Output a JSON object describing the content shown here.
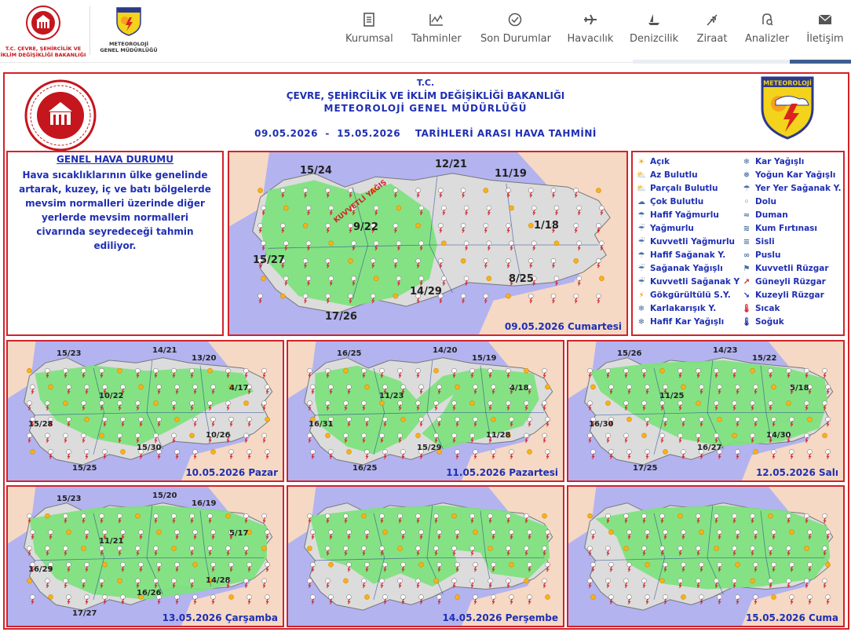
{
  "header": {
    "ministry_logo_text": [
      "T.C. ÇEVRE, ŞEHİRCİLİK VE",
      "İKLİM DEĞİŞİKLİĞİ BAKANLIĞI"
    ],
    "mgm_logo_text": [
      "METEOROLOJİ",
      "GENEL MÜDÜRLÜĞÜ"
    ],
    "shield_text": "METEOROLOJİ",
    "nav": [
      {
        "label": "Kurumsal",
        "icon": "document-icon"
      },
      {
        "label": "Tahminler",
        "icon": "chart-icon"
      },
      {
        "label": "Son Durumlar",
        "icon": "clock-icon"
      },
      {
        "label": "Havacılık",
        "icon": "airplane-icon"
      },
      {
        "label": "Denizcilik",
        "icon": "ship-icon"
      },
      {
        "label": "Ziraat",
        "icon": "wheat-icon"
      },
      {
        "label": "Analizler",
        "icon": "analysis-icon"
      },
      {
        "label": "İletişim",
        "icon": "envelope-icon"
      }
    ]
  },
  "forecast": {
    "title_lines": [
      "T.C.",
      "ÇEVRE, ŞEHİRCİLİK VE İKLİM DEĞİŞİKLİĞİ BAKANLIĞI",
      "METEOROLOJİ GENEL MÜDÜRLÜĞÜ"
    ],
    "date_line": "09.05.2026  -  15.05.2026    TARİHLERİ ARASI HAVA TAHMİNİ",
    "genel_title": "GENEL HAVA DURUMU",
    "genel_text": "Hava sıcaklıklarının ülke genelinde artarak, kuzey, iç ve batı bölgelerde mevsim normalleri üzerinde diğer yerlerde mevsim normalleri civarında seyredeceği tahmin ediliyor.",
    "main_map": {
      "caption": "09.05.2026 Cumartesi",
      "warning_label": "KUVVETLİ YAĞIŞ",
      "temps": [
        "15/24",
        "12/21",
        "11/19",
        "9/22",
        "1/18",
        "15/27",
        "8/25",
        "14/29",
        "17/26"
      ]
    },
    "days": [
      {
        "caption": "10.05.2026 Pazar",
        "temps": [
          "15/23",
          "14/21",
          "13/20",
          "10/22",
          "4/17",
          "15/28",
          "10/26",
          "15/30",
          "15/25"
        ]
      },
      {
        "caption": "11.05.2026 Pazartesi",
        "temps": [
          "16/25",
          "14/20",
          "15/19",
          "11/23",
          "4/18",
          "16/31",
          "11/28",
          "15/29",
          "16/25"
        ]
      },
      {
        "caption": "12.05.2026 Salı",
        "temps": [
          "15/26",
          "14/23",
          "15/22",
          "11/25",
          "5/18",
          "16/30",
          "14/30",
          "16/27",
          "17/25"
        ]
      },
      {
        "caption": "13.05.2026 Çarşamba",
        "temps": [
          "15/23",
          "15/20",
          "16/19",
          "11/21",
          "5/17",
          "16/29",
          "14/28",
          "16/26",
          "17/27"
        ]
      },
      {
        "caption": "14.05.2026 Perşembe",
        "temps": []
      },
      {
        "caption": "15.05.2026 Cuma",
        "temps": []
      }
    ],
    "legend_left": [
      {
        "label": "Açık",
        "icon": "sun-icon"
      },
      {
        "label": "Az Bulutlu",
        "icon": "partly-sunny-icon"
      },
      {
        "label": "Parçalı Bulutlu",
        "icon": "partly-cloudy-icon"
      },
      {
        "label": "Çok Bulutlu",
        "icon": "cloudy-icon"
      },
      {
        "label": "Hafif Yağmurlu",
        "icon": "light-rain-icon"
      },
      {
        "label": "Yağmurlu",
        "icon": "rain-icon"
      },
      {
        "label": "Kuvvetli Yağmurlu",
        "icon": "heavy-rain-icon"
      },
      {
        "label": "Hafif Sağanak Y.",
        "icon": "light-shower-icon"
      },
      {
        "label": "Sağanak Yağışlı",
        "icon": "shower-icon"
      },
      {
        "label": "Kuvvetli Sağanak Y",
        "icon": "heavy-shower-icon"
      },
      {
        "label": "Gökgürültülü S.Y.",
        "icon": "thunderstorm-icon"
      },
      {
        "label": "Karlakarışık Y.",
        "icon": "sleet-icon"
      },
      {
        "label": "Hafif Kar Yağışlı",
        "icon": "light-snow-icon"
      }
    ],
    "legend_right": [
      {
        "label": "Kar Yağışlı",
        "icon": "snow-icon"
      },
      {
        "label": "Yoğun Kar Yağışlı",
        "icon": "heavy-snow-icon"
      },
      {
        "label": "Yer Yer Sağanak Y.",
        "icon": "scattered-shower-icon"
      },
      {
        "label": "Dolu",
        "icon": "hail-icon"
      },
      {
        "label": "Duman",
        "icon": "smoke-icon"
      },
      {
        "label": "Kum Fırtınası",
        "icon": "sandstorm-icon"
      },
      {
        "label": "Sisli",
        "icon": "fog-icon"
      },
      {
        "label": "Puslu",
        "icon": "haze-icon"
      },
      {
        "label": "Kuvvetli Rüzgar",
        "icon": "strong-wind-icon"
      },
      {
        "label": "Güneyli Rüzgar",
        "icon": "south-wind-icon"
      },
      {
        "label": "Kuzeyli Rüzgar",
        "icon": "north-wind-icon"
      },
      {
        "label": "Sıcak",
        "icon": "hot-icon"
      },
      {
        "label": "Soğuk",
        "icon": "cold-icon"
      }
    ]
  },
  "colors": {
    "frame_red": "#d3222a",
    "title_blue": "#1f2fb3",
    "land_green": "#7ee27e",
    "land_gray": "#dcdcdc",
    "sea_blue": "#b3b3f0",
    "neighbor_peach": "#f5d9c4"
  }
}
